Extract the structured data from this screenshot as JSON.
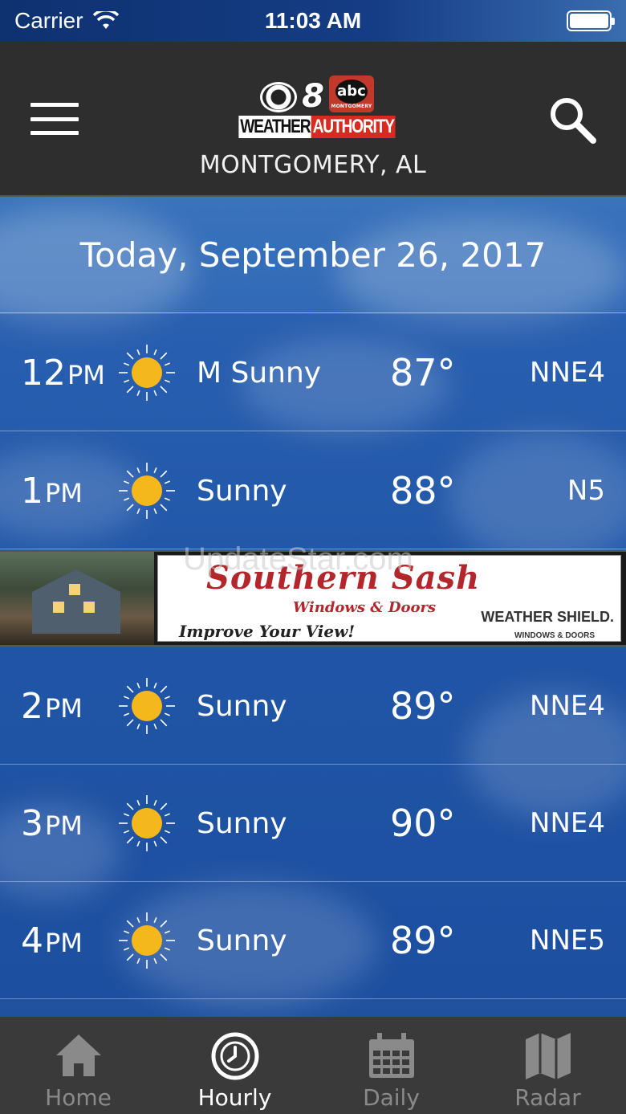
{
  "status_bar": {
    "carrier": "Carrier",
    "time": "11:03 AM"
  },
  "header": {
    "logo_channel": "8",
    "logo_network": "abc",
    "logo_network_sub": "MONTGOMERY",
    "logo_text_white": "WEATHER",
    "logo_text_red": "AUTHORITY",
    "location": "MONTGOMERY, AL"
  },
  "date_heading": "Today, September 26, 2017",
  "hourly": [
    {
      "hour": "12",
      "period": "PM",
      "icon": "sun-icon",
      "condition": "M Sunny",
      "temp": "87°",
      "wind": "NNE4"
    },
    {
      "hour": "1",
      "period": "PM",
      "icon": "sun-icon",
      "condition": "Sunny",
      "temp": "88°",
      "wind": "N5"
    },
    {
      "hour": "2",
      "period": "PM",
      "icon": "sun-icon",
      "condition": "Sunny",
      "temp": "89°",
      "wind": "NNE4"
    },
    {
      "hour": "3",
      "period": "PM",
      "icon": "sun-icon",
      "condition": "Sunny",
      "temp": "90°",
      "wind": "NNE4"
    },
    {
      "hour": "4",
      "period": "PM",
      "icon": "sun-icon",
      "condition": "Sunny",
      "temp": "89°",
      "wind": "NNE5"
    }
  ],
  "ad": {
    "title": "Southern Sash",
    "subtitle": "Windows & Doors",
    "tagline": "Improve Your View!",
    "brand": "WEATHER SHIELD.",
    "brand_sub": "WINDOWS & DOORS"
  },
  "watermark": "UpdateStar.com",
  "tabs": [
    {
      "label": "Home",
      "icon": "home-icon",
      "active": false
    },
    {
      "label": "Hourly",
      "icon": "clock-icon",
      "active": true
    },
    {
      "label": "Daily",
      "icon": "calendar-icon",
      "active": false
    },
    {
      "label": "Radar",
      "icon": "map-icon",
      "active": false
    }
  ],
  "colors": {
    "sun": "#f5b81c",
    "logo_red": "#d62b20",
    "header_bg": "#2e2e2e",
    "tabbar_bg": "#3a3a3a"
  }
}
